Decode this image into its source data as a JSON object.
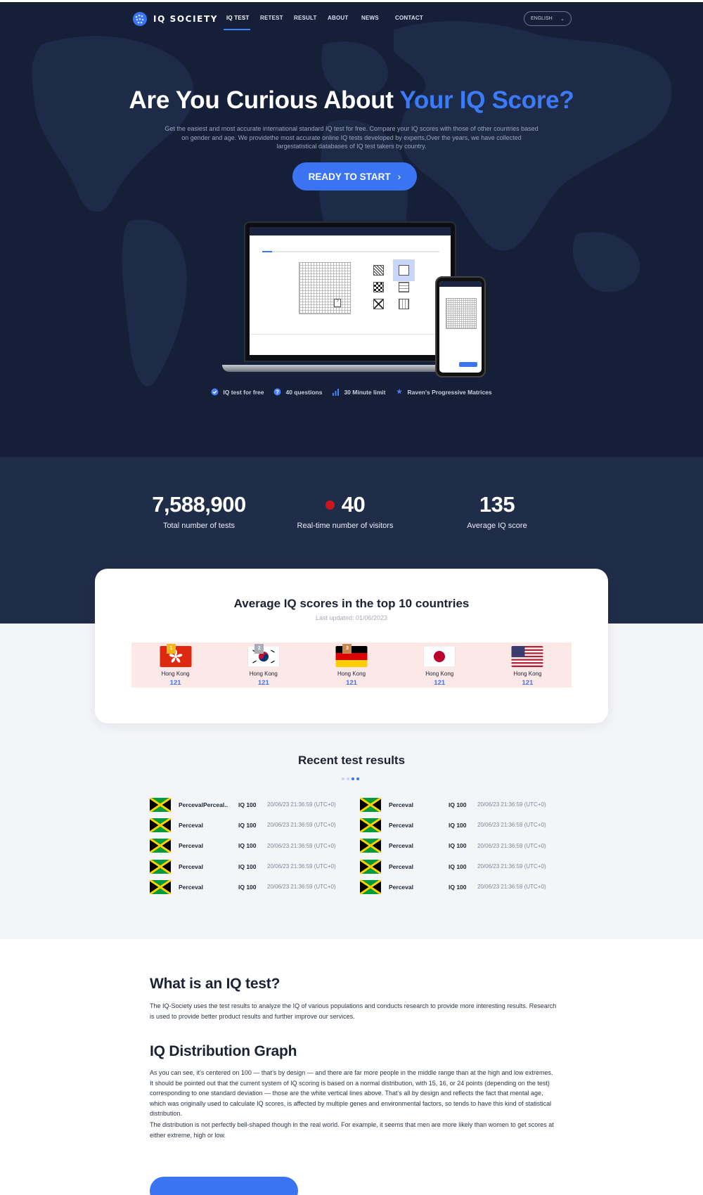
{
  "nav": {
    "logo": "IQ SOCIETY",
    "links": [
      "IQ TEST",
      "RETEST",
      "RESULT",
      "ABOUT",
      "NEWS",
      "CONTACT"
    ],
    "active_index": 0,
    "language": "ENGLISH"
  },
  "hero": {
    "title_plain": "Are You Curious About ",
    "title_accent": "Your IQ Score?",
    "description": "Get the easiest and most accurate international standard IQ test for free. Compare your IQ scores with those of other countries based on gender and age. We providethe most accurate online IQ tests developed by experts,Over the years, we have collected largestatistical databases of IQ test takers by country.",
    "cta_label": "READY TO START",
    "features": [
      {
        "icon": "check-circle-icon",
        "label": "IQ test for free"
      },
      {
        "icon": "question-icon",
        "label": "40 questions"
      },
      {
        "icon": "bar-chart-icon",
        "label": "30 Minute limit"
      },
      {
        "icon": "star-icon",
        "label": "Raven's Progressive Matrices"
      }
    ]
  },
  "stats": [
    {
      "value": "7,588,900",
      "label": "Total number of tests"
    },
    {
      "value": "40",
      "label": "Real-time number of visitors"
    },
    {
      "value": "135",
      "label": "Average IQ score"
    }
  ],
  "top10": {
    "title": "Average IQ scores in the top 10 countries",
    "updated": "Last updated: 01/06/2023",
    "countries": [
      {
        "rank": "1",
        "flag": "hong-kong",
        "name": "Hong Kong",
        "score": "121"
      },
      {
        "rank": "2",
        "flag": "south-korea",
        "name": "Hong Kong",
        "score": "121"
      },
      {
        "rank": "3",
        "flag": "germany",
        "name": "Hong Kong",
        "score": "121"
      },
      {
        "rank": "",
        "flag": "japan",
        "name": "Hong Kong",
        "score": "121"
      },
      {
        "rank": "",
        "flag": "usa",
        "name": "Hong Kong",
        "score": "121"
      }
    ]
  },
  "recent": {
    "title": "Recent test results",
    "rows": [
      {
        "name": "PercevalPerceal..",
        "iq": "IQ 100",
        "time": "20/06/23 21:36:59 (UTC+0)"
      },
      {
        "name": "Perceval",
        "iq": "IQ 100",
        "time": "20/06/23 21:36:59 (UTC+0)"
      },
      {
        "name": "Perceval",
        "iq": "IQ 100",
        "time": "20/06/23 21:36:59 (UTC+0)"
      },
      {
        "name": "Perceval",
        "iq": "IQ 100",
        "time": "20/06/23 21:36:59 (UTC+0)"
      },
      {
        "name": "Perceval",
        "iq": "IQ 100",
        "time": "20/06/23 21:36:59 (UTC+0)"
      },
      {
        "name": "Perceval",
        "iq": "IQ 100",
        "time": "20/06/23 21:36:59 (UTC+0)"
      },
      {
        "name": "Perceval",
        "iq": "IQ 100",
        "time": "20/06/23 21:36:59 (UTC+0)"
      },
      {
        "name": "Perceval",
        "iq": "IQ 100",
        "time": "20/06/23 21:36:59 (UTC+0)"
      },
      {
        "name": "Perceval",
        "iq": "IQ 100",
        "time": "20/06/23 21:36:59 (UTC+0)"
      },
      {
        "name": "Perceval",
        "iq": "IQ 100",
        "time": "20/06/23 21:36:59 (UTC+0)"
      }
    ]
  },
  "info": {
    "what_title": "What is an IQ test?",
    "what_text": "The IQ-Society uses the test results to analyze the IQ of various populations and conducts research to provide more interesting results. Research is used to provide better product results and further improve our services.",
    "graph_title": "IQ Distribution Graph",
    "graph_text_1": "As you can see, it’s centered on 100 — that’s by design — and there are far more people in the middle range than at the high and low extremes. It should be pointed out that the current system of IQ scoring is based on a normal distribution, with 15, 16, or 24 points (depending on the test) corresponding to one standard deviation — those are the white vertical lines above. That’s all by design and reflects the fact that mental age, which was originally used to calculate IQ scores, is affected by multiple genes and environmental factors, so tends to have this kind of statistical distribution.",
    "graph_text_2": "The distribution is not perfectly bell-shaped though in the real world. For example, it seems that men are more likely than women to get scores at either extreme, high or low."
  },
  "colors": {
    "navy": "#152038",
    "stats_bg": "#202d48",
    "accent": "#3b74f2",
    "live": "#c9161f"
  }
}
